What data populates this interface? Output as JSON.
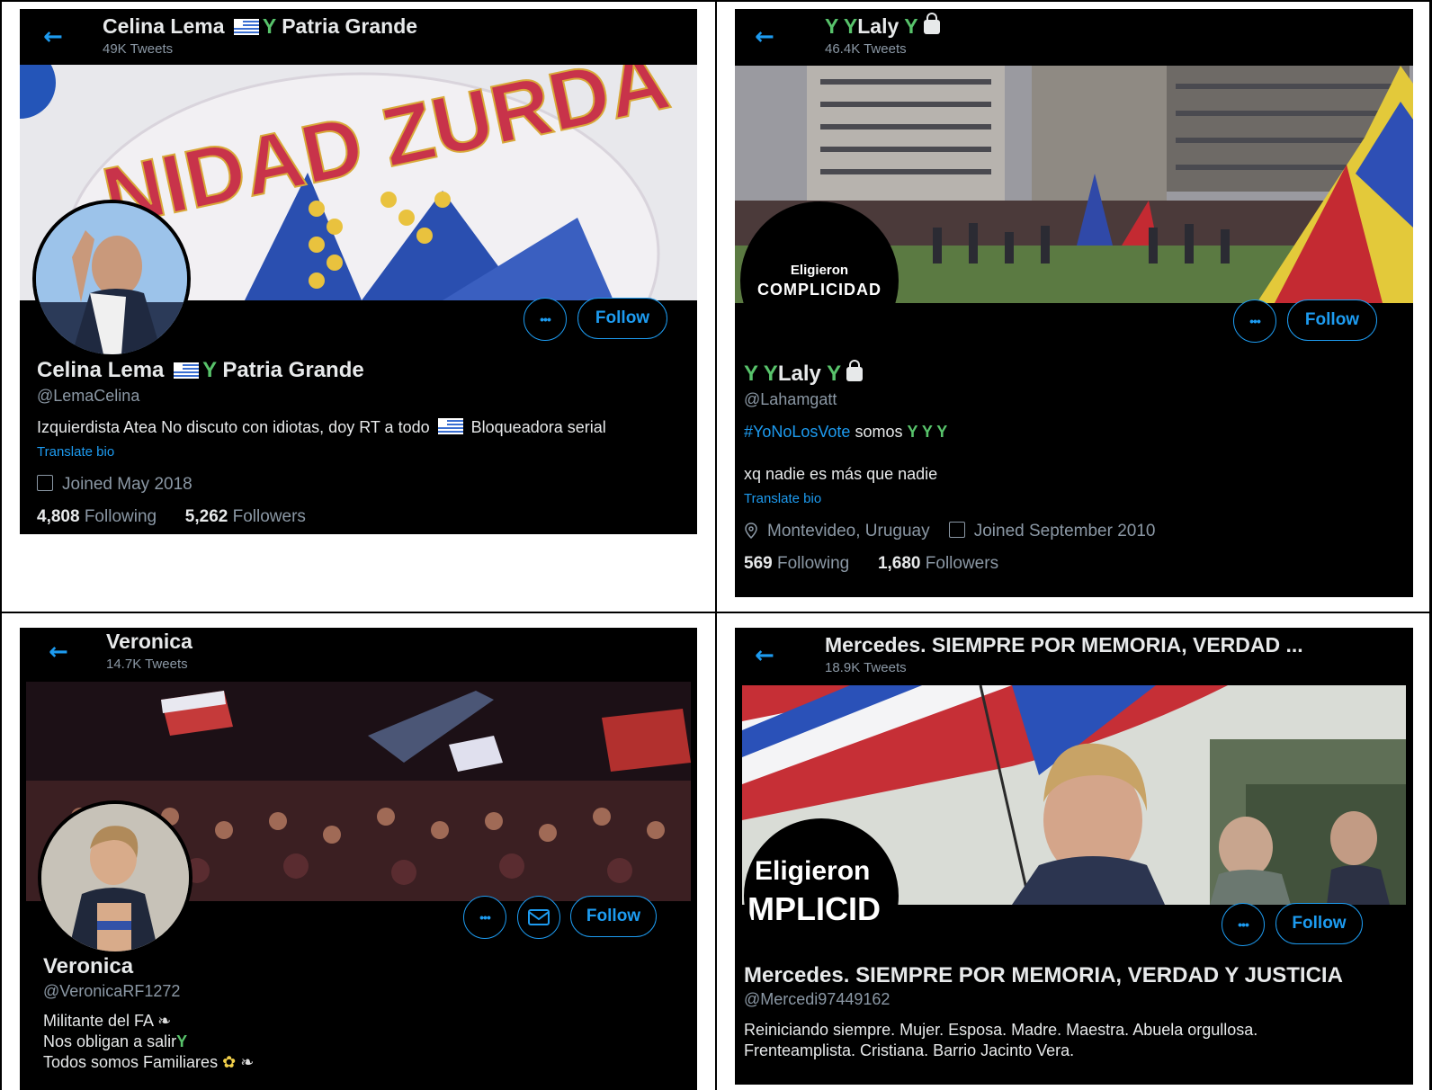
{
  "profiles": [
    {
      "top_name": "Celina Lema",
      "top_suffix": "Patria Grande",
      "tweets": "49K Tweets",
      "banner_text": "NIDAD ZURDA",
      "name": "Celina Lema",
      "name_suffix": "Patria Grande",
      "handle": "@LemaCelina",
      "bio": "Izquierdista Atea No discuto con idiotas, doy RT a todo",
      "bio_tail": "Bloqueadora serial",
      "translate": "Translate bio",
      "joined": "Joined May 2018",
      "following_count": "4,808",
      "following_label": "Following",
      "followers_count": "5,262",
      "followers_label": "Followers",
      "follow_label": "Follow",
      "more_label": "•••"
    },
    {
      "top_name": "Laly",
      "tweets": "46.4K Tweets",
      "avatar_line1": "Eligieron",
      "avatar_line2": "COMPLICIDAD",
      "name": "Laly",
      "handle": "@Lahamgatt",
      "hashtag": "#YoNoLosVote",
      "bio_word": "somos",
      "bio_line2": "xq nadie es más que nadie",
      "translate": "Translate bio",
      "location": "Montevideo, Uruguay",
      "joined": "Joined September 2010",
      "following_count": "569",
      "following_label": "Following",
      "followers_count": "1,680",
      "followers_label": "Followers",
      "follow_label": "Follow",
      "more_label": "•••"
    },
    {
      "top_name": "Veronica",
      "tweets": "14.7K Tweets",
      "name": "Veronica",
      "handle": "@VeronicaRF1272",
      "bio_line1": "Militante del FA",
      "bio_line2": "Nos obligan a salir",
      "bio_line3": "Todos somos Familiares",
      "follow_label": "Follow",
      "more_label": "•••"
    },
    {
      "top_name": "Mercedes. SIEMPRE POR MEMORIA, VERDAD ...",
      "tweets": "18.9K Tweets",
      "avatar_line1": "Eligieron",
      "avatar_line2": "MPLICID",
      "name": "Mercedes. SIEMPRE POR MEMORIA, VERDAD Y JUSTICIA",
      "handle": "@Mercedi97449162",
      "bio_line1": "Reiniciando siempre. Mujer. Esposa. Madre. Maestra. Abuela orgullosa.",
      "bio_line2": "Frenteamplista. Cristiana. Barrio Jacinto Vera.",
      "follow_label": "Follow",
      "more_label": "•••"
    }
  ],
  "colors": {
    "accent": "#1d9bf0",
    "background": "#000000",
    "text": "#e7e9ea",
    "muted": "#8b98a5"
  }
}
